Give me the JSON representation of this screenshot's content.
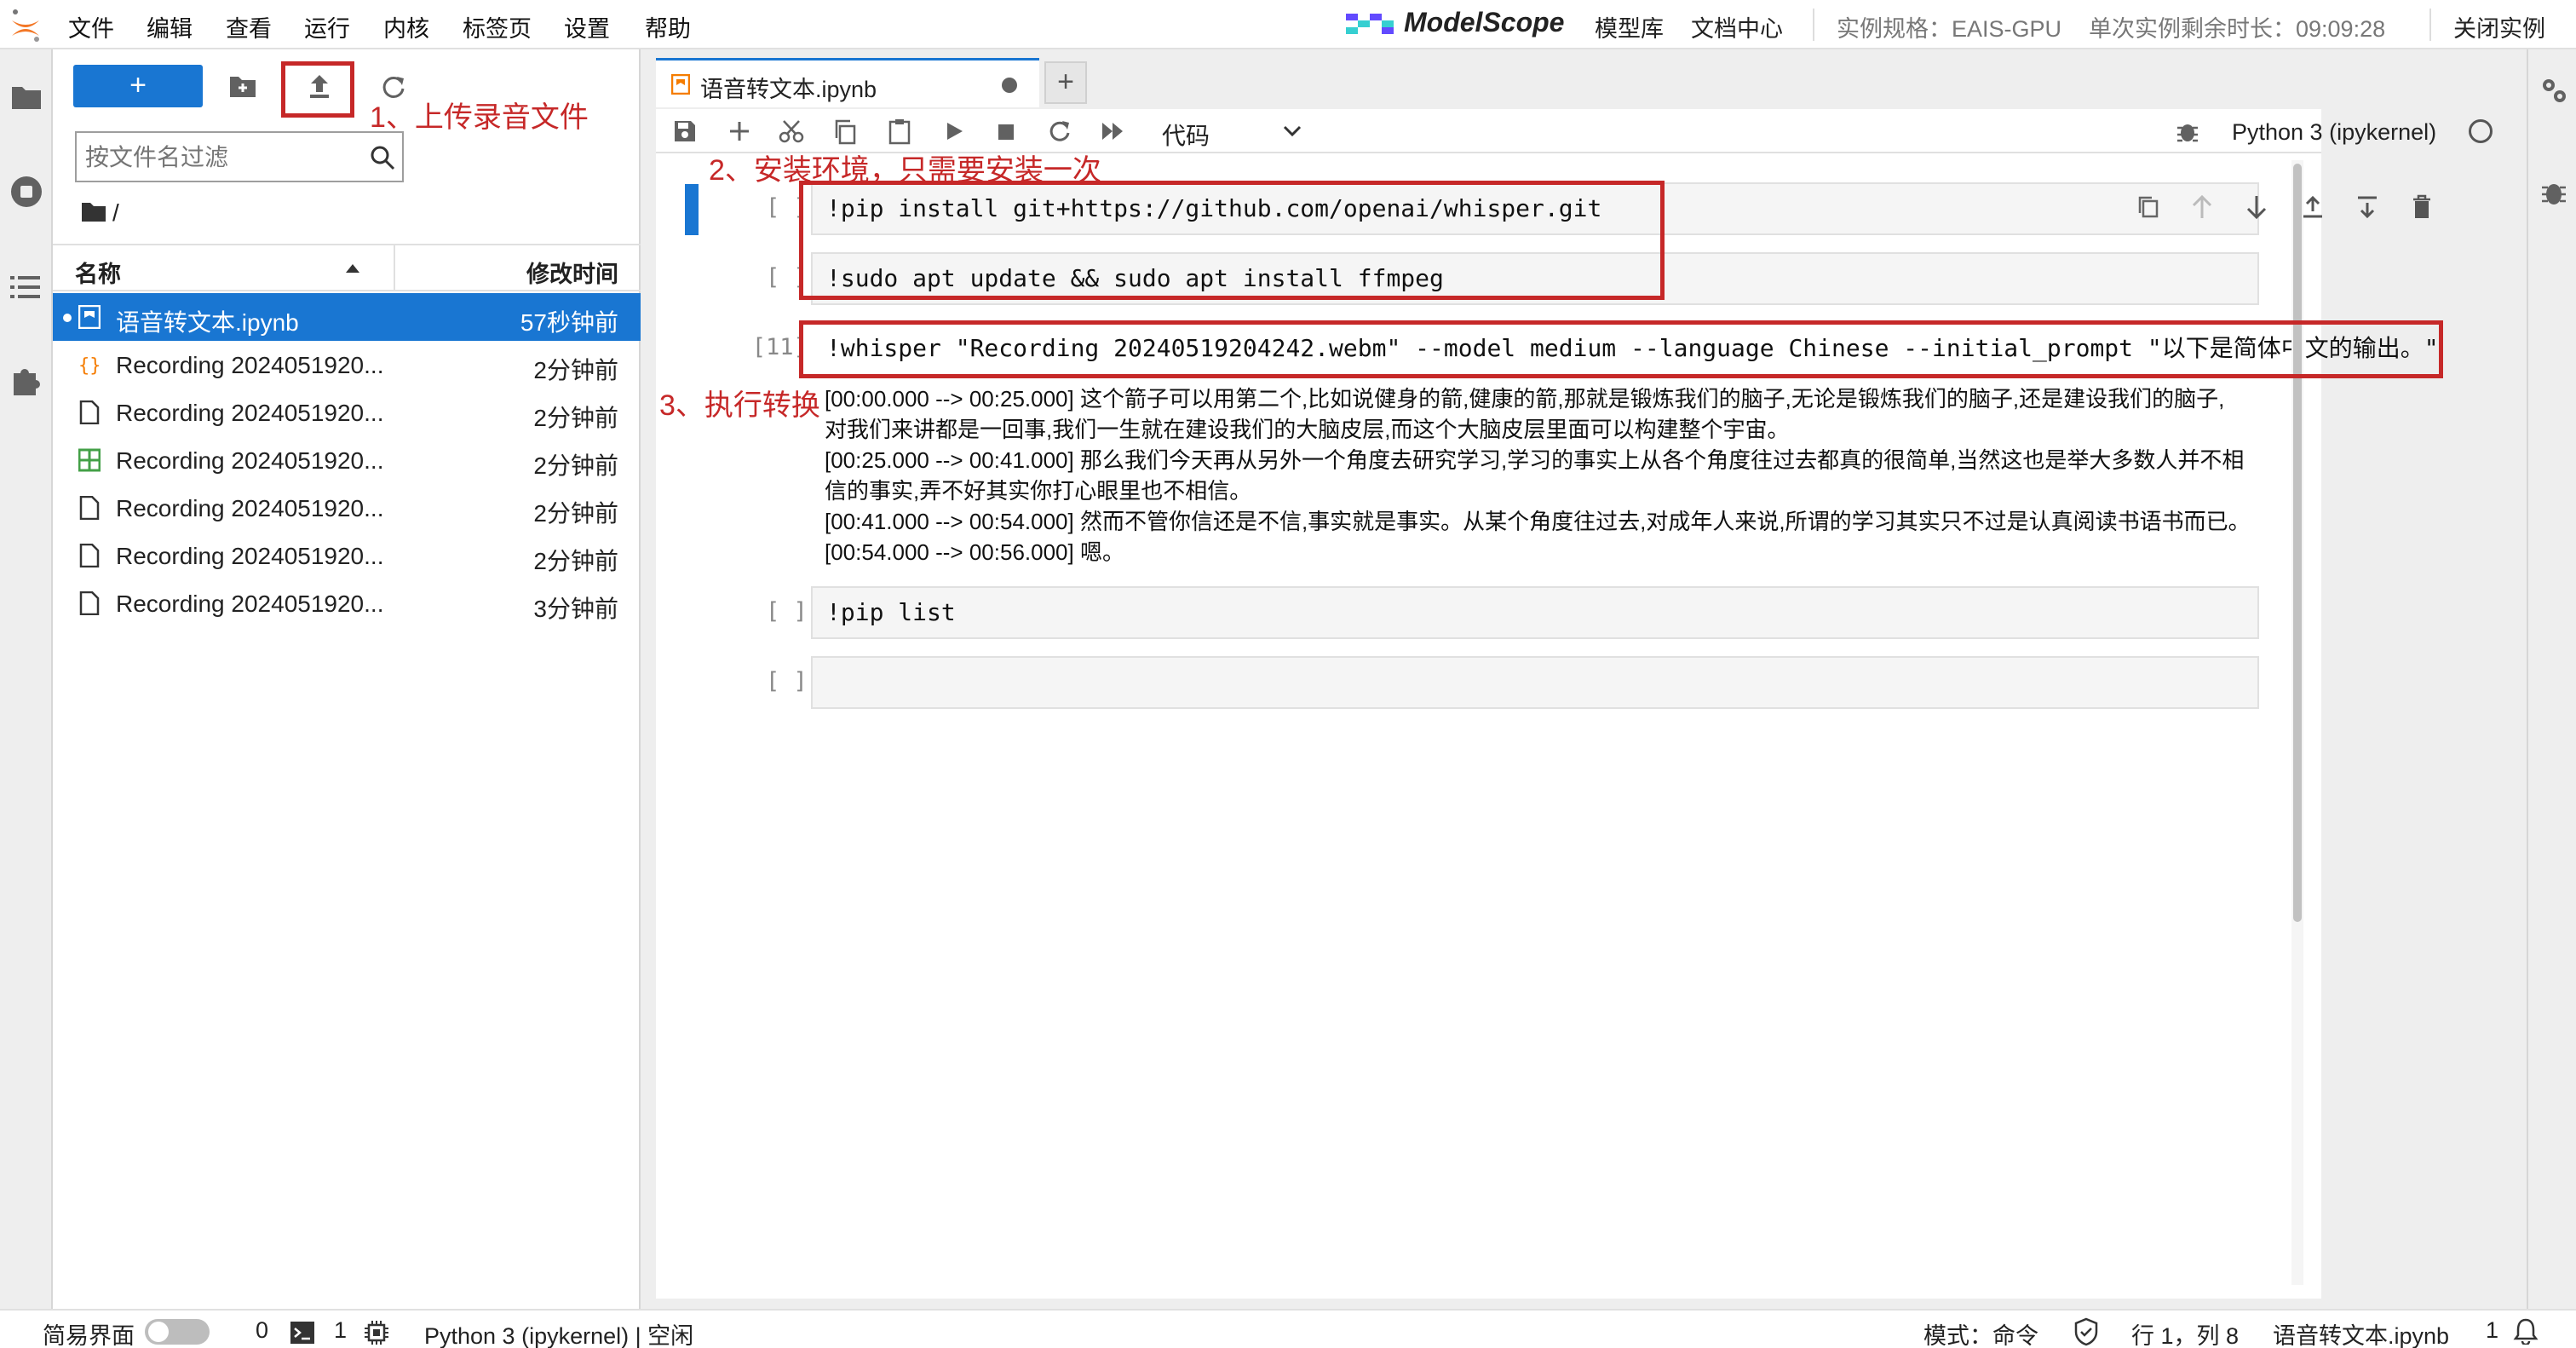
{
  "menubar": {
    "items": [
      "文件",
      "编辑",
      "查看",
      "运行",
      "内核",
      "标签页",
      "设置",
      "帮助"
    ],
    "brand": "ModelScope",
    "links": [
      "模型库",
      "文档中心"
    ],
    "instance_spec": "实例规格：EAIS-GPU",
    "remaining_time": "单次实例剩余时长：09:09:28",
    "close_instance": "关闭实例"
  },
  "filebrowser": {
    "new_button": "+",
    "filter_placeholder": "按文件名过滤",
    "path": "/",
    "col_name": "名称",
    "col_modified": "修改时间",
    "files": [
      {
        "name": "语音转文本.ipynb",
        "modified": "57秒钟前",
        "type": "notebook",
        "selected": true
      },
      {
        "name": "Recording 2024051920...",
        "modified": "2分钟前",
        "type": "json"
      },
      {
        "name": "Recording 2024051920...",
        "modified": "2分钟前",
        "type": "file"
      },
      {
        "name": "Recording 2024051920...",
        "modified": "2分钟前",
        "type": "table"
      },
      {
        "name": "Recording 2024051920...",
        "modified": "2分钟前",
        "type": "file"
      },
      {
        "name": "Recording 2024051920...",
        "modified": "2分钟前",
        "type": "file"
      },
      {
        "name": "Recording 2024051920...",
        "modified": "3分钟前",
        "type": "file"
      }
    ]
  },
  "notebook": {
    "tab_title": "语音转文本.ipynb",
    "cell_type": "代码",
    "kernel": "Python 3 (ipykernel)",
    "cells": [
      {
        "prompt": "[ ]:",
        "code": "!pip install git+https://github.com/openai/whisper.git"
      },
      {
        "prompt": "[ ]:",
        "code": "!sudo apt update && sudo apt install ffmpeg"
      },
      {
        "prompt": "[11]:",
        "code": "!whisper \"Recording 20240519204242.webm\" --model medium --language Chinese --initial_prompt \"以下是简体中文的输出。\""
      },
      {
        "prompt": "[ ]:",
        "code": "!pip list"
      },
      {
        "prompt": "[ ]:",
        "code": ""
      }
    ],
    "output_lines": [
      "[00:00.000 --> 00:25.000] 这个箭子可以用第二个,比如说健身的箭,健康的箭,那就是锻炼我们的脑子,无论是锻炼我们的脑子,还是建设我们的脑子,",
      "对我们来讲都是一回事,我们一生就在建设我们的大脑皮层,而这个大脑皮层里面可以构建整个宇宙。",
      "[00:25.000 --> 00:41.000] 那么我们今天再从另外一个角度去研究学习,学习的事实上从各个角度往过去都真的很简单,当然这也是举大多数人并不相",
      "信的事实,弄不好其实你打心眼里也不相信。",
      "[00:41.000 --> 00:54.000] 然而不管你信还是不信,事实就是事实。从某个角度往过去,对成年人来说,所谓的学习其实只不过是认真阅读书语书而已。",
      "[00:54.000 --> 00:56.000] 嗯。"
    ]
  },
  "annotations": {
    "a1": "1、上传录音文件",
    "a2": "2、安装环境，只需要安装一次",
    "a3": "3、执行转换"
  },
  "statusbar": {
    "simple_mode": "简易界面",
    "count1": "0",
    "count2": "1",
    "kernel_status": "Python 3 (ipykernel) | 空闲",
    "mode": "模式：命令",
    "position": "行 1，列 8",
    "file": "语音转文本.ipynb",
    "bell_count": "1"
  },
  "colors": {
    "accent": "#1976d2",
    "annotation": "#c62828",
    "selected_row": "#1976d2"
  }
}
